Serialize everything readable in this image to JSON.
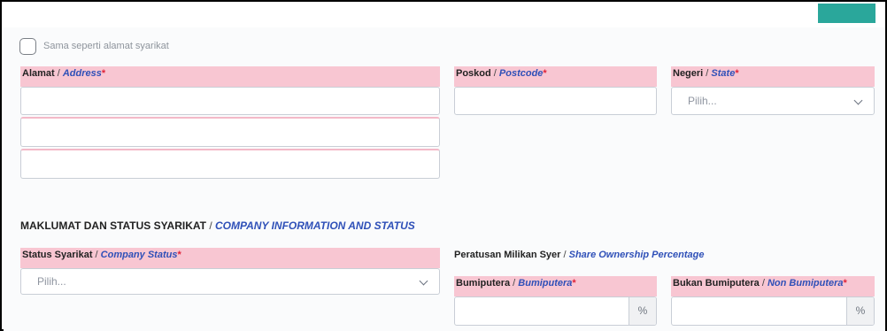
{
  "checkbox": {
    "label": "Sama seperti alamat syarikat",
    "checked": false
  },
  "address": {
    "label_ms": "Alamat",
    "separator": " / ",
    "label_en": "Address",
    "required_mark": "*",
    "lines": [
      "",
      "",
      ""
    ]
  },
  "postcode": {
    "label_ms": "Poskod",
    "separator": " / ",
    "label_en": "Postcode",
    "required_mark": "*",
    "value": ""
  },
  "state": {
    "label_ms": "Negeri",
    "separator": " / ",
    "label_en": "State",
    "required_mark": "*",
    "selected": "Pilih..."
  },
  "section": {
    "title_ms": "MAKLUMAT DAN STATUS SYARIKAT",
    "separator": " / ",
    "title_en": "COMPANY INFORMATION AND STATUS"
  },
  "company_status": {
    "label_ms": "Status Syarikat",
    "separator": " / ",
    "label_en": "Company Status",
    "required_mark": "*",
    "selected": "Pilih..."
  },
  "ownership": {
    "label_ms": "Peratusan Milikan Syer",
    "separator": " / ",
    "label_en": "Share Ownership Percentage"
  },
  "bumiputera": {
    "label_ms": "Bumiputera",
    "separator": " / ",
    "label_en": "Bumiputera",
    "required_mark": "*",
    "value": "",
    "suffix": "%"
  },
  "non_bumiputera": {
    "label_ms": "Bukan Bumiputera",
    "separator": " / ",
    "label_en": "Non Bumiputera",
    "required_mark": "*",
    "value": "",
    "suffix": "%"
  },
  "colors": {
    "label_bg": "#f8c6d2",
    "accent": "#2aa79b",
    "english_label": "#2f50b8",
    "required": "#e0243a"
  }
}
